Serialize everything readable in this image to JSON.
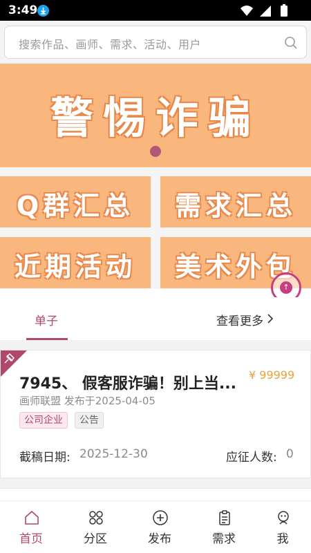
{
  "status_bar": {
    "time": "3:49"
  },
  "search": {
    "placeholder": "搜索作品、画师、需求、活动、用户"
  },
  "banner": {
    "title": "警惕诈骗"
  },
  "tiles": [
    {
      "label": "Q群汇总"
    },
    {
      "label": "需求汇总"
    },
    {
      "label": "近期活动"
    },
    {
      "label": "美术外包"
    }
  ],
  "section": {
    "active_tab": "单子",
    "see_more": "查看更多"
  },
  "card": {
    "title": "7945、 假客服诈骗！别上当...",
    "price": "¥ 99999",
    "meta": "画师联盟 发布于2025-04-05",
    "tags": [
      "公司企业",
      "公告"
    ],
    "deadline_label": "截稿日期:",
    "deadline_value": "2025-12-30",
    "applicants_label": "应征人数:",
    "applicants_value": "0"
  },
  "bottom_nav": [
    {
      "label": "首页",
      "icon": "home-icon"
    },
    {
      "label": "分区",
      "icon": "grid-icon"
    },
    {
      "label": "发布",
      "icon": "plus-circle-icon"
    },
    {
      "label": "需求",
      "icon": "clipboard-icon"
    },
    {
      "label": "我",
      "icon": "profile-icon"
    }
  ],
  "colors": {
    "accent": "#b0476c",
    "banner": "#f9b77e",
    "price": "#e8a23a"
  }
}
